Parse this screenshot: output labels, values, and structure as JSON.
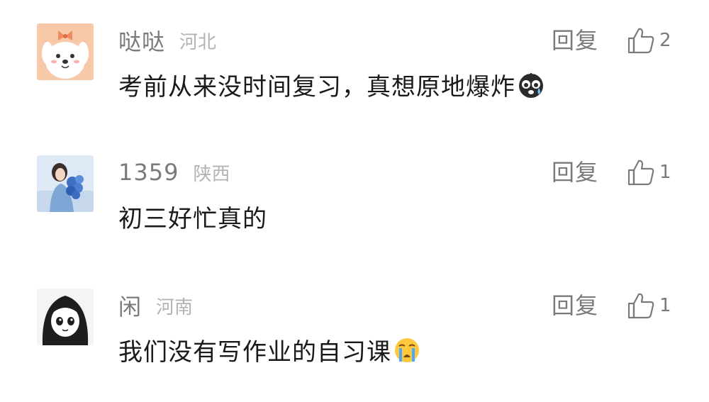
{
  "comments": [
    {
      "username": "哒哒",
      "location": "河北",
      "content": "考前从来没时间复习，真想原地爆炸",
      "reply_label": "回复",
      "like_count": "2",
      "avatar_icon": "white-puppy-with-bow-avatar",
      "emoji_icon": "shocked-face-emoji"
    },
    {
      "username": "1359",
      "location": "陕西",
      "content": "初三好忙真的",
      "reply_label": "回复",
      "like_count": "1",
      "avatar_icon": "girl-with-blue-flowers-avatar"
    },
    {
      "username": "闲",
      "location": "河南",
      "content": "我们没有写作业的自习课",
      "reply_label": "回复",
      "like_count": "1",
      "avatar_icon": "manga-girl-sketch-avatar",
      "emoji_icon": "crying-face-emoji"
    }
  ],
  "colors": {
    "username": "#7a7a7a",
    "location": "#b3b3b3",
    "content": "#1a1a1a",
    "action": "#7a7a7a"
  }
}
